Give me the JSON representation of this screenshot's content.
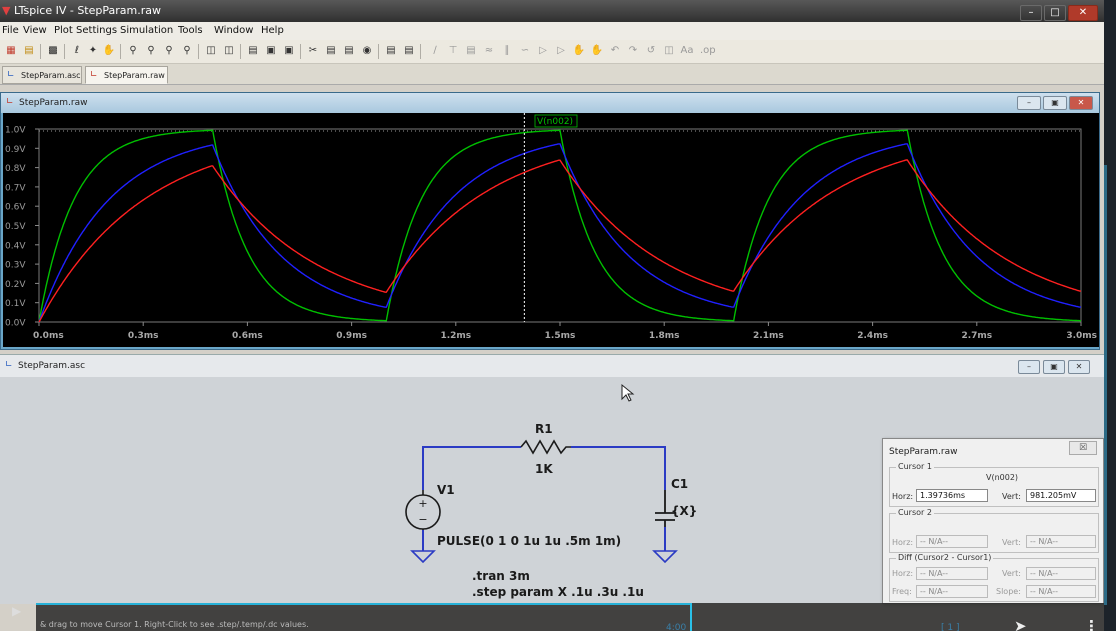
{
  "window": {
    "title": "LTspice IV - StepParam.raw"
  },
  "menu": [
    "File",
    "View",
    "Plot Settings",
    "Simulation",
    "Tools",
    "Window",
    "Help"
  ],
  "tabs": [
    {
      "label": "StepParam.asc",
      "active": false
    },
    {
      "label": "StepParam.raw",
      "active": true
    }
  ],
  "plot_window": {
    "title": "StepParam.raw",
    "trace_label": "V(n002)"
  },
  "schematic_window": {
    "title": "StepParam.asc",
    "components": {
      "r1_name": "R1",
      "r1_value": "1K",
      "c1_name": "C1",
      "c1_value": "{X}",
      "v1_name": "V1",
      "v1_value": "PULSE(0 1 0 1u 1u .5m 1m)",
      "v1_plus": "+",
      "v1_minus": "−"
    },
    "directives": [
      ".tran 3m",
      ".step param X .1u .3u .1u"
    ]
  },
  "cursor_dialog": {
    "title": "StepParam.raw",
    "close_glyph": "☒",
    "cursor1_label": "Cursor 1",
    "cursor1_trace": "V(n002)",
    "horz_label": "Horz:",
    "horz_value": "1.39736ms",
    "vert_label": "Vert:",
    "vert_value": "981.205mV",
    "cursor2_label": "Cursor 2",
    "cursor2_horz_label": "Horz:",
    "cursor2_horz_value": "-- N/A--",
    "cursor2_vert_label": "Vert:",
    "cursor2_vert_value": "-- N/A--",
    "diff_label": "Diff (Cursor2 - Cursor1)",
    "diff_horz_label": "Horz:",
    "diff_horz_value": "-- N/A--",
    "diff_vert_label": "Vert:",
    "diff_vert_value": "-- N/A--",
    "freq_label": "Freq:",
    "freq_value": "-- N/A--",
    "slope_label": "Slope:",
    "slope_value": "-- N/A--"
  },
  "status_bar": {
    "text": "& drag to move Cursor 1. Right-Click to see .step/.temp/.dc values."
  },
  "video_overlay": {
    "time_a": "4:00",
    "time_b": "[ 1 ]"
  },
  "colors": {
    "plot_bg": "#000000",
    "axis": "#808080",
    "green_trace": "#00c000",
    "blue_trace": "#2020ff",
    "red_trace": "#ff2020",
    "wire": "#2b3bc4",
    "component": "#1a1a1a"
  },
  "chart_data": {
    "type": "line",
    "title": "V(n002)",
    "xlabel": "",
    "ylabel": "",
    "xlim": [
      0,
      3.0
    ],
    "ylim": [
      0,
      1.0
    ],
    "x_ticks": [
      "0.0ms",
      "0.3ms",
      "0.6ms",
      "0.9ms",
      "1.2ms",
      "1.5ms",
      "1.8ms",
      "2.1ms",
      "2.4ms",
      "2.7ms",
      "3.0ms"
    ],
    "y_ticks": [
      "0.0V",
      "0.1V",
      "0.2V",
      "0.3V",
      "0.4V",
      "0.5V",
      "0.6V",
      "0.7V",
      "0.8V",
      "0.9V",
      "1.0V"
    ],
    "cursor_x": 1.39736,
    "series": [
      {
        "color": "#00c000",
        "tau_ms": 0.1
      },
      {
        "color": "#2020ff",
        "tau_ms": 0.2
      },
      {
        "color": "#ff2020",
        "tau_ms": 0.3
      }
    ],
    "pulse": {
      "v1": 0,
      "v2": 1,
      "on_ms": 0.5,
      "period_ms": 1.0,
      "stop_ms": 3.0
    }
  }
}
